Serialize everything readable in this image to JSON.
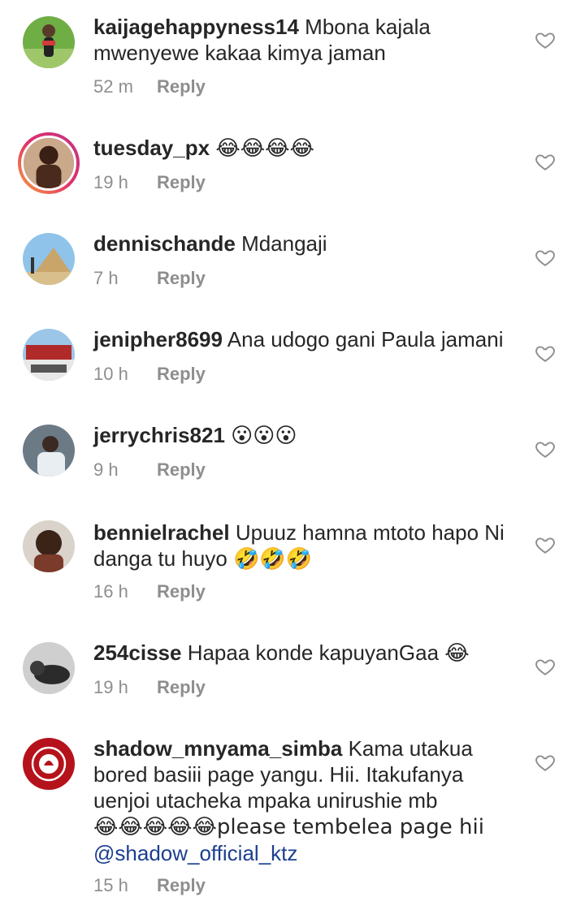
{
  "comments": [
    {
      "username": "kaijagehappyness14",
      "text_lines": [
        "Mbona kajala",
        "mwenyewe kakaa kimya jaman"
      ],
      "time": "52 m",
      "reply": "Reply"
    },
    {
      "username": "tuesday_px",
      "text_lines": [
        "😂😂😂😂"
      ],
      "time": "19 h",
      "reply": "Reply"
    },
    {
      "username": "dennischande",
      "text_lines": [
        "Mdangaji"
      ],
      "time": "7 h",
      "reply": "Reply"
    },
    {
      "username": "jenipher8699",
      "text_lines": [
        "Ana udogo gani Paula jamani"
      ],
      "time": "10 h",
      "reply": "Reply"
    },
    {
      "username": "jerrychris821",
      "text_lines": [
        "😮😮😮"
      ],
      "time": "9 h",
      "reply": "Reply"
    },
    {
      "username": "bennielrachel",
      "text_lines": [
        "Upuuz hamna mtoto hapo Ni",
        "danga tu huyo 🤣🤣🤣"
      ],
      "time": "16 h",
      "reply": "Reply"
    },
    {
      "username": "254cisse",
      "text_lines": [
        "Hapaa konde kapuyanGaa 😂"
      ],
      "time": "19 h",
      "reply": "Reply"
    },
    {
      "username": "shadow_mnyama_simba",
      "text_lines": [
        "Kama utakua",
        "bored basiii page yangu. Hii. Itakufanya",
        "uenjoi  utacheka mpaka unirushie mb",
        "😂😂😂😂😂please tembelea page hii"
      ],
      "mention": "@shadow_official_ktz",
      "time": "15 h",
      "reply": "Reply"
    }
  ],
  "icons": {
    "like": "heart-outline-icon"
  },
  "colors": {
    "text": "#262626",
    "meta": "#8e8e8e",
    "mention": "#1c3f8f",
    "story_ring_start": "#f9a13a",
    "story_ring_end": "#c13584"
  }
}
